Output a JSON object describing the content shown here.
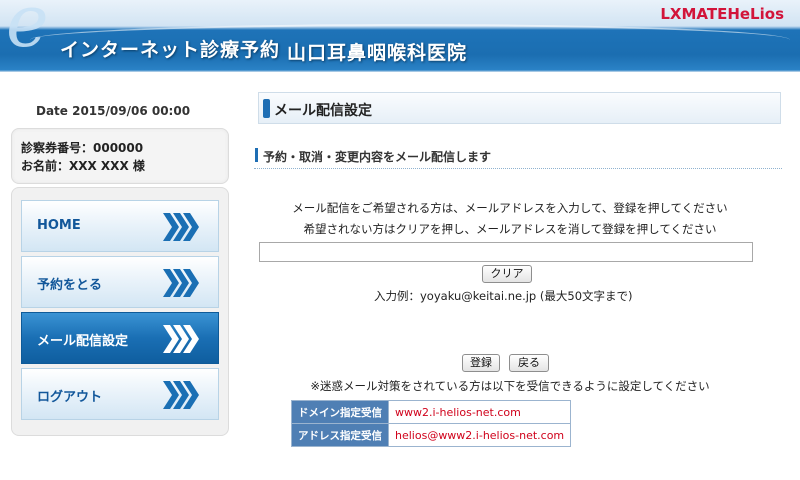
{
  "header": {
    "service_title": "インターネット診療予約",
    "clinic_name": "山口耳鼻咽喉科医院",
    "brand": "LXMATEHeLios"
  },
  "sidebar": {
    "date": "Date 2015/09/06 00:00",
    "patient_number": "診察券番号：000000",
    "patient_name": "お名前：XXX XXX 様",
    "items": [
      {
        "label": "HOME"
      },
      {
        "label": "予約をとる"
      },
      {
        "label": "メール配信設定"
      },
      {
        "label": "ログアウト"
      }
    ]
  },
  "main": {
    "page_title": "メール配信設定",
    "section_title": "予約・取消・変更内容をメール配信します",
    "instruction_1": "メール配信をご希望される方は、メールアドレスを入力して、登録を押してください",
    "instruction_2": "希望されない方はクリアを押し、メールアドレスを消して登録を押してください",
    "email_value": "",
    "clear_label": "クリア",
    "example": "入力例：yoyaku@keitai.ne.jp (最大50文字まで)",
    "register_label": "登録",
    "back_label": "戻る",
    "spam_note": "※迷惑メール対策をされている方は以下を受信できるように設定してください",
    "receive_table": [
      {
        "header": "ドメイン指定受信",
        "value": "www2.i-helios-net.com"
      },
      {
        "header": "アドレス指定受信",
        "value": "helios@www2.i-helios-net.com"
      }
    ]
  },
  "colors": {
    "header_blue": "#1b6eb1",
    "nav_text": "#12579a",
    "table_header": "#4f7fb4",
    "table_value": "#d0021b",
    "brand_red": "#d2143a"
  }
}
